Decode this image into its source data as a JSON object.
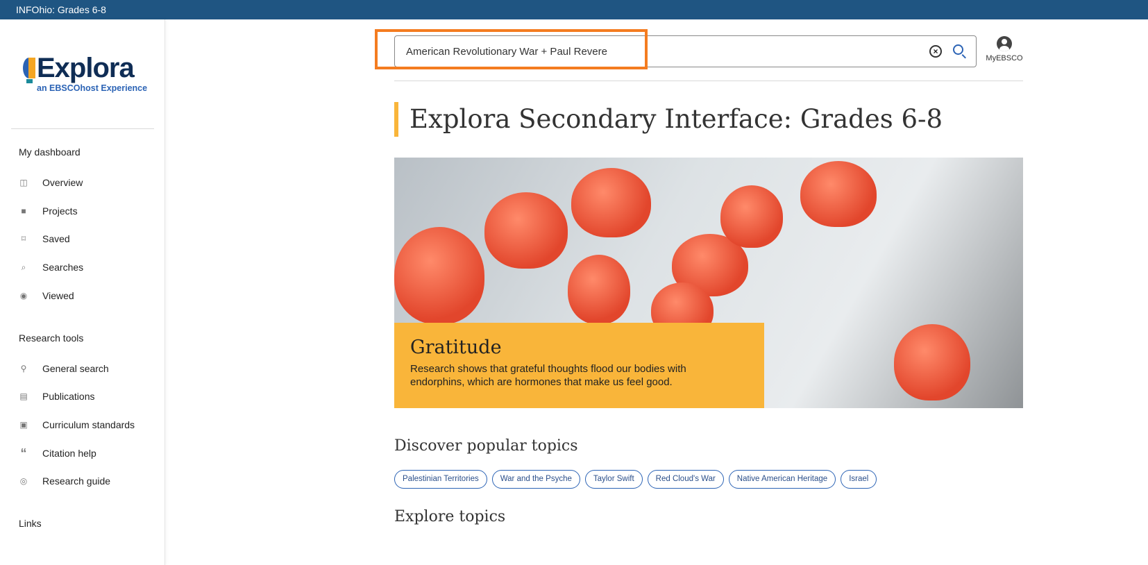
{
  "topbar": {
    "title": "INFOhio: Grades 6-8"
  },
  "logo": {
    "word": "Explora",
    "tagline": "an EBSCOhost Experience"
  },
  "sidebar": {
    "sections": [
      {
        "label": "My dashboard",
        "items": [
          {
            "label": "Overview",
            "icon": "layout-icon"
          },
          {
            "label": "Projects",
            "icon": "folder-icon"
          },
          {
            "label": "Saved",
            "icon": "bookmark-icon"
          },
          {
            "label": "Searches",
            "icon": "search-document-icon"
          },
          {
            "label": "Viewed",
            "icon": "eye-icon"
          }
        ]
      },
      {
        "label": "Research tools",
        "items": [
          {
            "label": "General search",
            "icon": "search-icon"
          },
          {
            "label": "Publications",
            "icon": "document-icon"
          },
          {
            "label": "Curriculum standards",
            "icon": "standards-icon"
          },
          {
            "label": "Citation help",
            "icon": "quote-icon"
          },
          {
            "label": "Research guide",
            "icon": "compass-icon"
          }
        ]
      },
      {
        "label": "Links",
        "items": []
      }
    ]
  },
  "search": {
    "value": "American Revolutionary War + Paul Revere"
  },
  "account": {
    "label": "MyEBSCO"
  },
  "main": {
    "title": "Explora Secondary Interface: Grades 6-8",
    "hero": {
      "heading": "Gratitude",
      "text": "Research shows that grateful thoughts flood our bodies with endorphins, which are hormones that make us feel good."
    },
    "popular_heading": "Discover popular topics",
    "topics": [
      "Palestinian Territories",
      "War and the Psyche",
      "Taylor Swift",
      "Red Cloud's War",
      "Native American Heritage",
      "Israel"
    ],
    "explore_heading": "Explore topics"
  },
  "colors": {
    "topbar": "#1f5582",
    "accent": "#f9b53a",
    "highlight": "#f47c20",
    "link": "#2b63b5"
  }
}
